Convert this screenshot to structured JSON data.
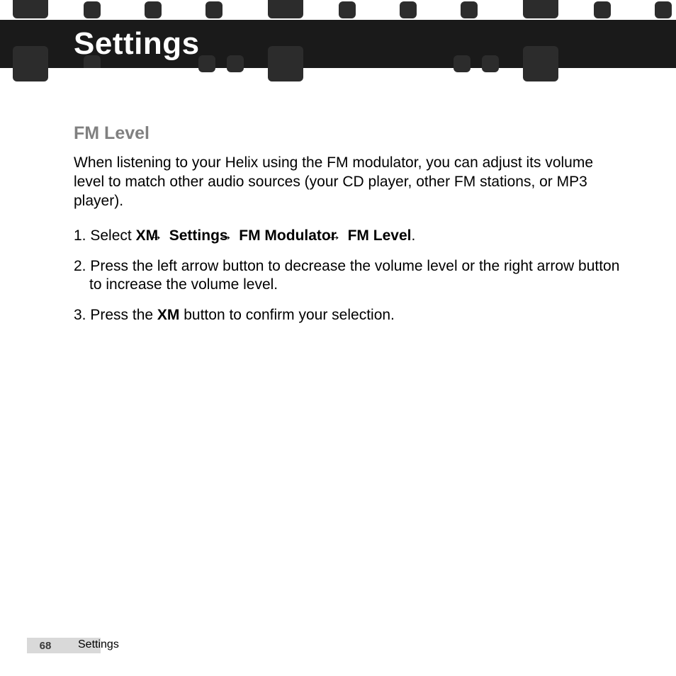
{
  "header": {
    "title": "Settings"
  },
  "section": {
    "heading": "FM Level",
    "intro": "When listening to your Helix using the FM modulator, you can adjust its volume level to match other audio sources (your CD player, other FM stations, or MP3 player).",
    "step1": {
      "num": "1. ",
      "pre": "Select ",
      "p1": "XM",
      "p2": "Settings",
      "p3": "FM Modulator",
      "p4": "FM Level",
      "post": "."
    },
    "step2": "2. Press the left arrow button to decrease the volume level or the right arrow button to increase the volume level.",
    "step3": {
      "num": "3. ",
      "pre": "Press the ",
      "bold": "XM",
      "post": " button to confirm your selection."
    }
  },
  "footer": {
    "page": "68",
    "section": "Settings"
  }
}
